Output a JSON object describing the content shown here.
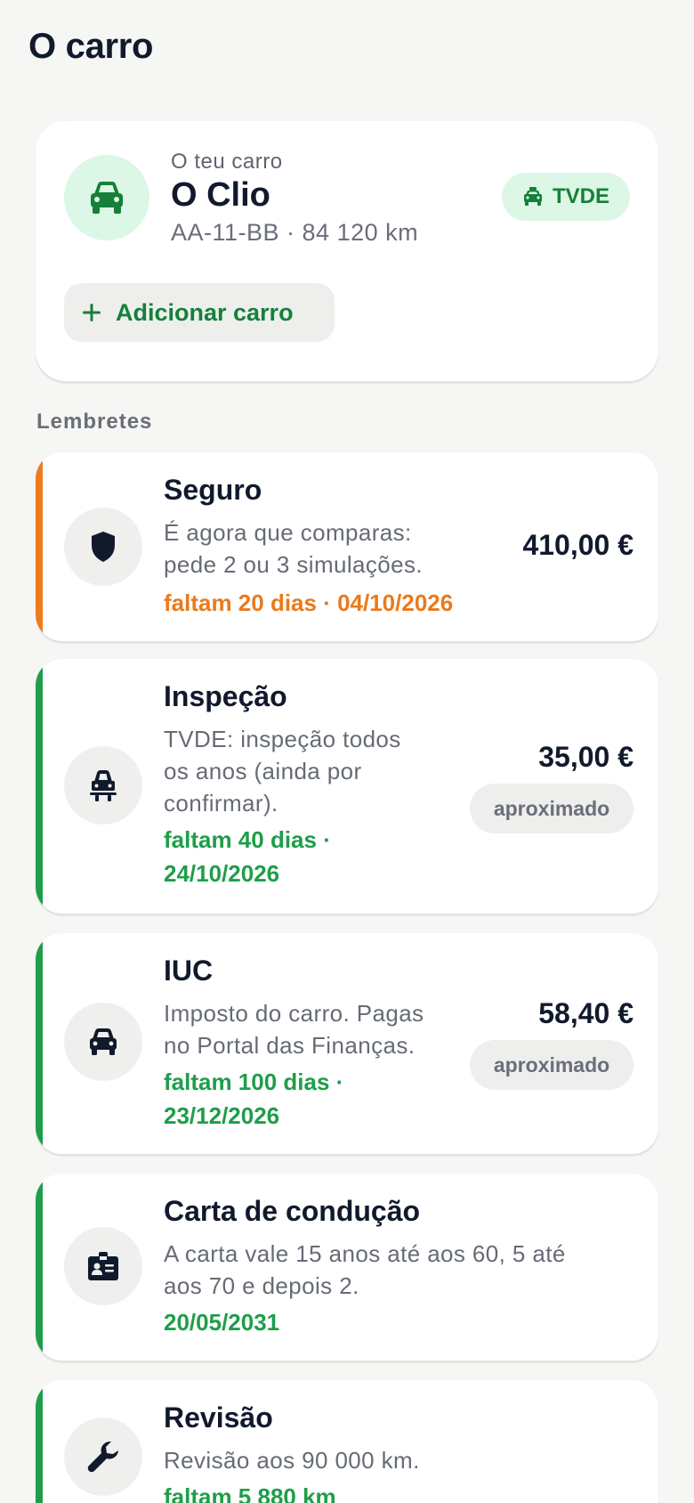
{
  "page_title": "O carro",
  "car": {
    "eyebrow": "O teu carro",
    "name": "O Clio",
    "meta": "AA-11-BB · 84 120 km",
    "badge_label": "TVDE",
    "badge_icon": "taxi-icon",
    "add_button_label": "Adicionar carro",
    "accent_color": "#16803a"
  },
  "reminders_label": "Lembretes",
  "reminders": [
    {
      "title": "Seguro",
      "desc_lines": [
        "É agora que comparas:",
        "pede 2 ou 3 simulações."
      ],
      "due_lines": [
        "faltam 20 dias · 04/10/2026"
      ],
      "amount": "410,00 €",
      "approx": "",
      "icon": "shield-icon",
      "status_color": "#ef7b1d"
    },
    {
      "title": "Inspeção",
      "desc_lines": [
        "TVDE: inspeção todos",
        "os anos (ainda por",
        "confirmar)."
      ],
      "due_lines": [
        "faltam 40 dias ·",
        "24/10/2026"
      ],
      "amount": "35,00 €",
      "approx": "aproximado",
      "icon": "inspection-icon",
      "status_color": "#1e9e4a"
    },
    {
      "title": "IUC",
      "desc_lines": [
        "Imposto do carro. Pagas",
        "no Portal das Finanças."
      ],
      "due_lines": [
        "faltam 100 dias ·",
        "23/12/2026"
      ],
      "amount": "58,40 €",
      "approx": "aproximado",
      "icon": "car-icon",
      "status_color": "#1e9e4a"
    },
    {
      "title": "Carta de condução",
      "desc_lines": [
        "A carta vale 15 anos até aos 60, 5 até",
        "aos 70 e depois 2."
      ],
      "due_lines": [
        "20/05/2031"
      ],
      "amount": "",
      "approx": "",
      "icon": "license-icon",
      "status_color": "#1e9e4a"
    },
    {
      "title": "Revisão",
      "desc_lines": [
        "Revisão aos 90 000 km."
      ],
      "due_lines": [
        "faltam 5 880 km"
      ],
      "amount": "",
      "approx": "",
      "icon": "wrench-icon",
      "status_color": "#1e9e4a"
    }
  ]
}
